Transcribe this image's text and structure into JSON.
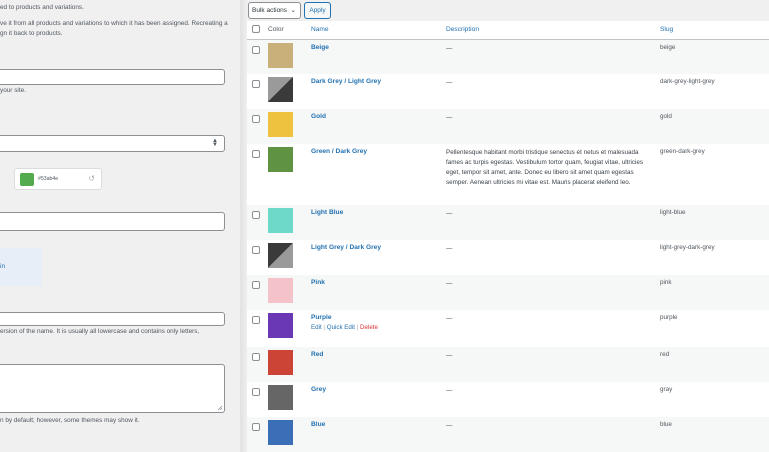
{
  "form": {
    "help_top": "ed to products and variations.",
    "help_top_2": "ve it from all products and variations to which it has been assigned. Recreating a",
    "help_top_3": "gn it back to products.",
    "name_help": "your site.",
    "color_hex": "#53ab4e",
    "color_swatch": "#53ab4e",
    "image_button": "in",
    "slug_help": "ersion of the name. It is usually all lowercase and contains only letters,",
    "desc_help": "n by default; however, some themes may show it."
  },
  "list": {
    "bulk_actions_label": "Bulk actions",
    "apply_label": "Apply",
    "columns": {
      "color": "Color",
      "name": "Name",
      "description": "Description",
      "slug": "Slug"
    },
    "rows": [
      {
        "name": "Beige",
        "description": "—",
        "slug": "beige",
        "color": "#c9b07a"
      },
      {
        "name": "Dark Grey / Light Grey",
        "description": "—",
        "slug": "dark-grey-light-grey",
        "color": "split-dark-light"
      },
      {
        "name": "Gold",
        "description": "—",
        "slug": "gold",
        "color": "#eec23f"
      },
      {
        "name": "Green / Dark Grey",
        "description": "Pellentesque habitant morbi tristique senectus et netus et malesuada fames ac turpis egestas. Vestibulum tortor quam, feugiat vitae, ultricies eget, tempor sit amet, ante. Donec eu libero sit amet quam egestas semper. Aenean ultricies mi vitae est. Mauris placerat eleifend leo.",
        "slug": "green-dark-grey",
        "color": "#5f9241"
      },
      {
        "name": "Light Blue",
        "description": "—",
        "slug": "light-blue",
        "color": "#6ed9c8"
      },
      {
        "name": "Light Grey / Dark Grey",
        "description": "—",
        "slug": "light-grey-dark-grey",
        "color": "split-light-dark"
      },
      {
        "name": "Pink",
        "description": "—",
        "slug": "pink",
        "color": "#f4c2c9"
      },
      {
        "name": "Purple",
        "description": "—",
        "slug": "purple",
        "color": "#6a38b5",
        "row_actions": {
          "edit": "Edit",
          "quick_edit": "Quick Edit",
          "delete": "Delete",
          "sep": "|"
        }
      },
      {
        "name": "Red",
        "description": "—",
        "slug": "red",
        "color": "#cc4436"
      },
      {
        "name": "Grey",
        "description": "—",
        "slug": "gray",
        "color": "#666666"
      },
      {
        "name": "Blue",
        "description": "—",
        "slug": "blue",
        "color": "#3a6fb8"
      }
    ]
  }
}
